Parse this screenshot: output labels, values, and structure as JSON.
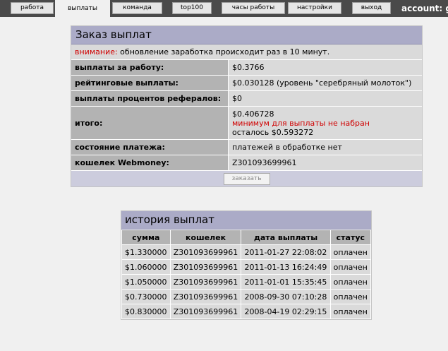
{
  "tabs": [
    "работа",
    "выплаты",
    "команда",
    "top100",
    "часы работы",
    "настройки",
    "выход"
  ],
  "account_label": "account: g",
  "order": {
    "title": "Заказ выплат",
    "notice_label": "внимание:",
    "notice_text": " обновление заработка происходит раз в 10 минут.",
    "rows": [
      {
        "label": "выплаты за работу:",
        "value": "$0.3766"
      },
      {
        "label": "рейтинговые выплаты:",
        "value": "$0.030128 (уровень \"серебряный молоток\")"
      },
      {
        "label": "выплаты процентов рефералов:",
        "value": "$0"
      }
    ],
    "total_label": "итого:",
    "total_value": "$0.406728",
    "total_warning": "минимум для выплаты не набран",
    "total_remaining": "осталось $0.593272",
    "status_label": "состояние платежа:",
    "status_value": "платежей в обработке нет",
    "wallet_label": "кошелек Webmoney:",
    "wallet_value": "Z301093699961",
    "order_button": "заказать"
  },
  "history": {
    "title": "история выплат",
    "columns": [
      "сумма",
      "кошелек",
      "дата выплаты",
      "статус"
    ],
    "rows": [
      [
        "$1.330000",
        "Z301093699961",
        "2011-01-27 22:08:02",
        "оплачен"
      ],
      [
        "$1.060000",
        "Z301093699961",
        "2011-01-13 16:24:49",
        "оплачен"
      ],
      [
        "$1.050000",
        "Z301093699961",
        "2011-01-01 15:35:45",
        "оплачен"
      ],
      [
        "$0.730000",
        "Z301093699961",
        "2008-09-30 07:10:28",
        "оплачен"
      ],
      [
        "$0.830000",
        "Z301093699961",
        "2008-04-19 02:29:15",
        "оплачен"
      ]
    ]
  }
}
